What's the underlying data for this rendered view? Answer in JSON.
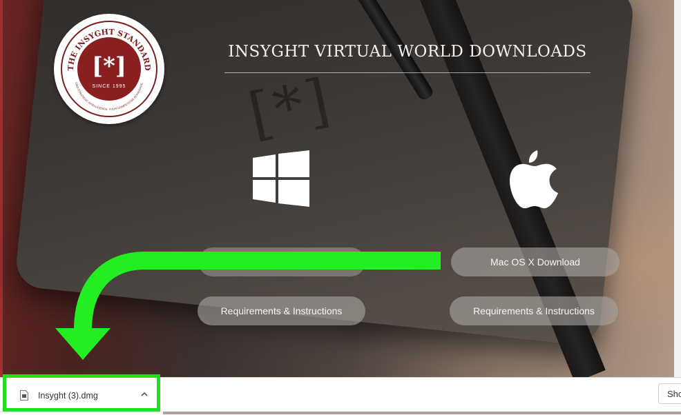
{
  "seal": {
    "name": "THE INSYGHT STANDARD",
    "mark": "[*]",
    "since": "SINCE 1995",
    "motto": "GEO-STRATEGIC INTELLIGENCE. YOUR COMPETITIVE ADVANTAGE."
  },
  "header": {
    "title": "INSYGHT VIRTUAL WORLD DOWNLOADS"
  },
  "platforms": {
    "windows": {
      "icon": "windows-logo-icon",
      "download_label": "",
      "requirements_label": "Requirements & Instructions"
    },
    "mac": {
      "icon": "apple-logo-icon",
      "download_label": "Mac OS X Download",
      "requirements_label": "Requirements & Instructions"
    }
  },
  "download_bar": {
    "file_name": "Insyght (3).dmg",
    "show_all_label": "Sho",
    "file_icon": "file-icon",
    "chevron_icon": "chevron-up-icon"
  },
  "colors": {
    "highlight_green": "#22dd22",
    "seal_red": "#8a1f1f"
  }
}
